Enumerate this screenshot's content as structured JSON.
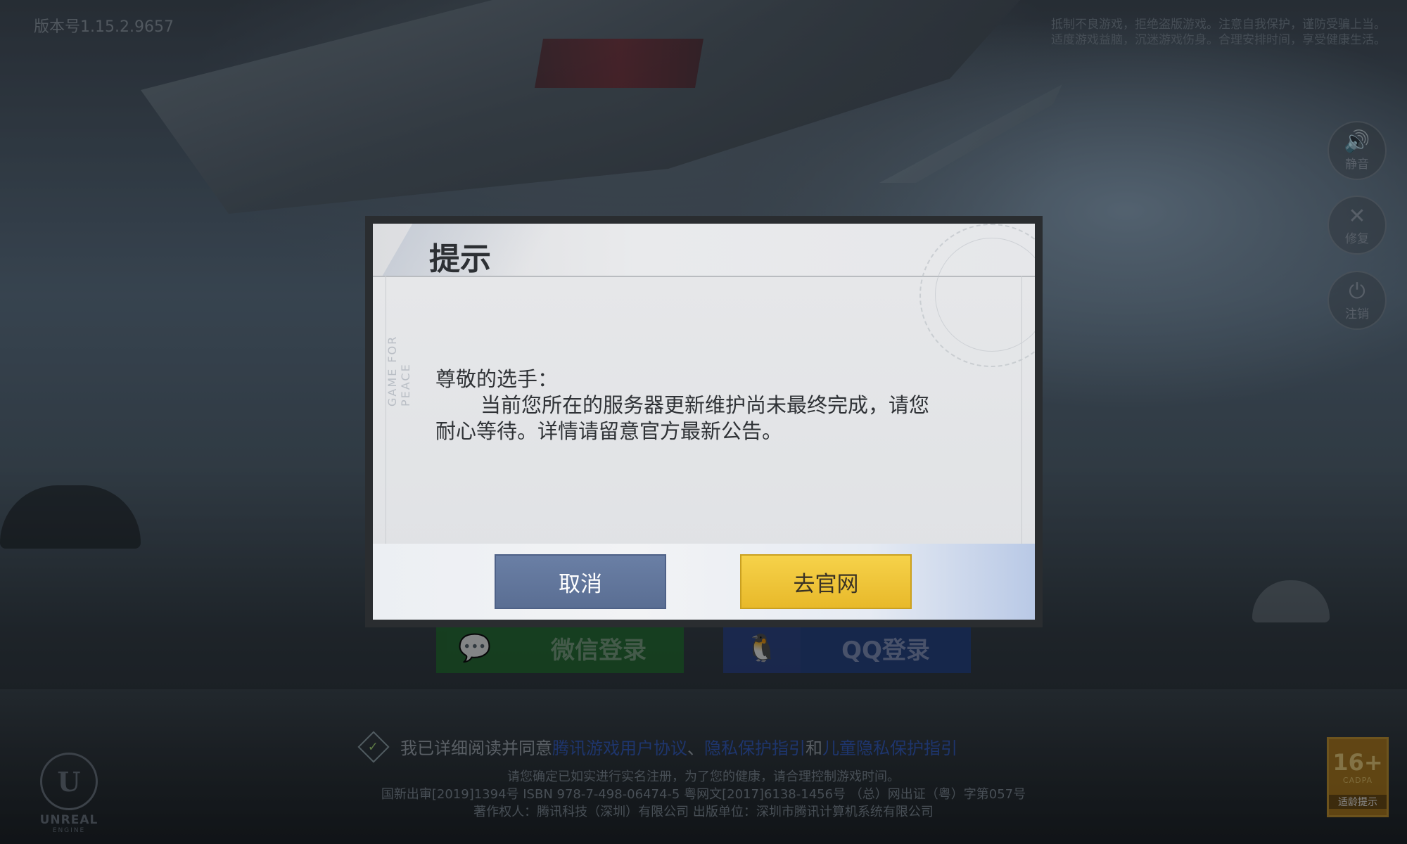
{
  "version": "版本号1.15.2.9657",
  "health_notice": [
    "抵制不良游戏，拒绝盗版游戏。注意自我保护，谨防受骗上当。",
    "适度游戏益脑，沉迷游戏伤身。合理安排时间，享受健康生活。"
  ],
  "side_buttons": [
    {
      "icon": "speaker-icon",
      "glyph": "🔊",
      "label": "静音"
    },
    {
      "icon": "wrench-icon",
      "glyph": "✕",
      "label": "修复"
    },
    {
      "icon": "power-icon",
      "glyph": "⏻",
      "label": "注销"
    }
  ],
  "login": {
    "wechat_label": "微信登录",
    "qq_label": "QQ登录"
  },
  "agreement": {
    "prefix": "我已详细阅读并同意",
    "link1": "腾讯游戏用户协议",
    "sep1": "、",
    "link2": "隐私保护指引",
    "and": " 和 ",
    "link3": "儿童隐私保护指引",
    "check": "✓"
  },
  "legal": {
    "line1": "请您确定已如实进行实名注册，为了您的健康，请合理控制游戏时间。",
    "line2": "国新出审[2019]1394号   ISBN 978-7-498-06474-5   粤网文[2017]6138-1456号  （总）网出证（粤）字第057号",
    "line3": "著作权人：腾讯科技（深圳）有限公司   出版单位：深圳市腾讯计算机系统有限公司"
  },
  "engine": {
    "mark": "U",
    "name": "UNREAL",
    "sub": "ENGINE"
  },
  "age_rating": {
    "number": "16+",
    "cadpa": "CADPA",
    "label": "适龄提示"
  },
  "dialog": {
    "title": "提示",
    "side_text": "GAME FOR PEACE",
    "greeting": "尊敬的选手：",
    "message_line1": "当前您所在的服务器更新维护尚未最终完成，请您",
    "message_line2": "耐心等待。详情请留意官方最新公告。",
    "cancel_label": "取消",
    "confirm_label": "去官网"
  },
  "colors": {
    "cancel_button": "#5f7399",
    "confirm_button": "#f0c53a",
    "link": "#2e52a8"
  }
}
